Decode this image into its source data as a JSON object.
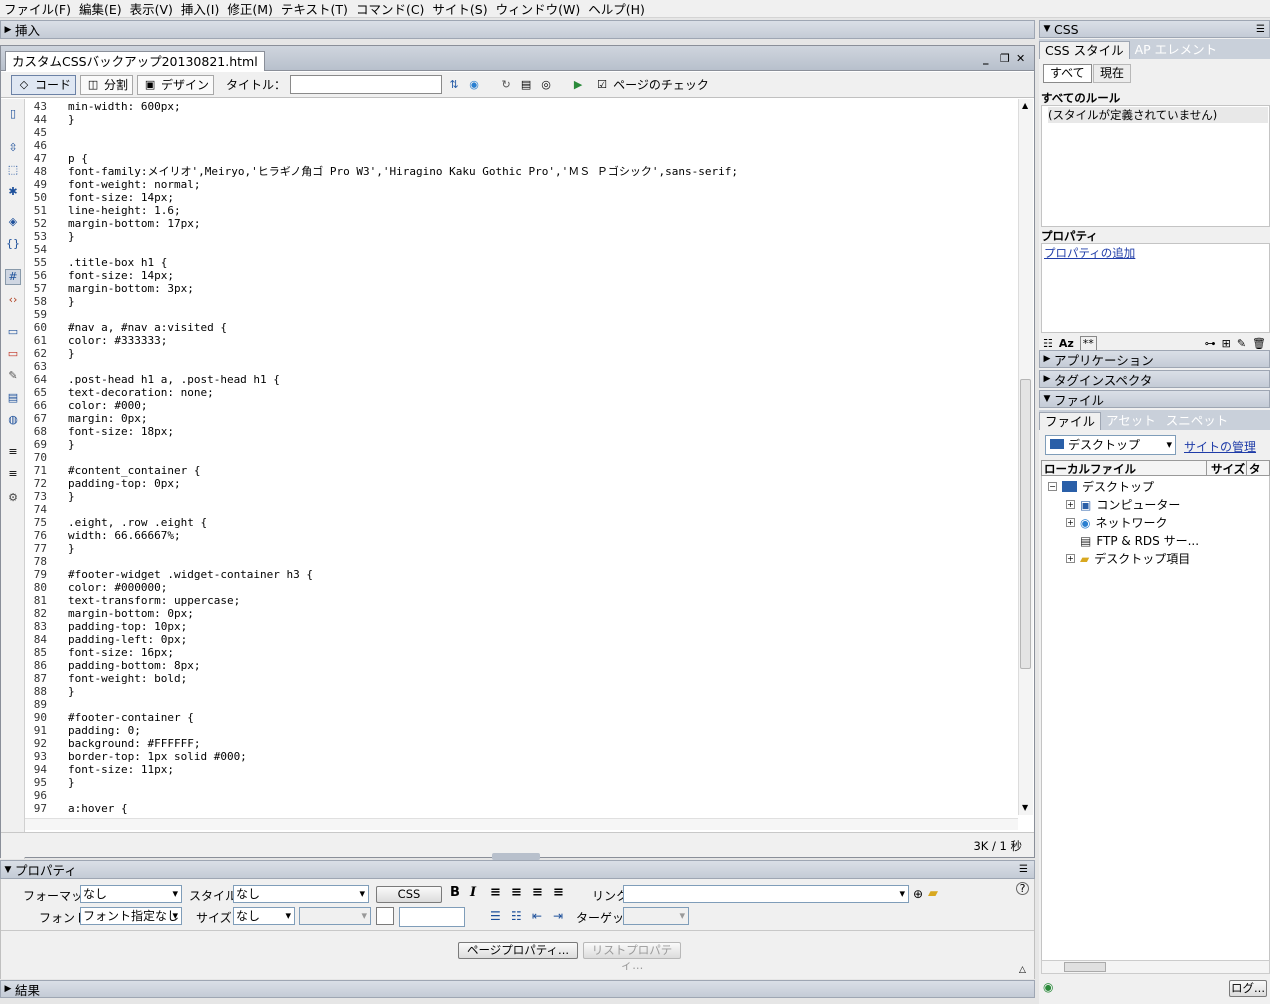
{
  "menu": [
    "ファイル(F)",
    "編集(E)",
    "表示(V)",
    "挿入(I)",
    "修正(M)",
    "テキスト(T)",
    "コマンド(C)",
    "サイト(S)",
    "ウィンドウ(W)",
    "ヘルプ(H)"
  ],
  "insert_panel": {
    "title": "挿入"
  },
  "document": {
    "tab_title": "カスタムCSSバックアップ20130821.html",
    "toolbar": {
      "code": "コード",
      "split": "分割",
      "design": "デザイン",
      "title_label": "タイトル：",
      "title_value": "",
      "check_page": "ページのチェック"
    },
    "lines": [
      {
        "n": "43",
        "t": "min-width: 600px;"
      },
      {
        "n": "44",
        "t": "}"
      },
      {
        "n": "45",
        "t": ""
      },
      {
        "n": "46",
        "t": ""
      },
      {
        "n": "47",
        "t": "p {"
      },
      {
        "n": "48",
        "t": "font-family:メイリオ',Meiryo,'ヒラギノ角ゴ Pro W3','Hiragino Kaku Gothic Pro','ＭＳ Ｐゴシック',sans-serif;"
      },
      {
        "n": "49",
        "t": "font-weight: normal;"
      },
      {
        "n": "50",
        "t": "font-size: 14px;"
      },
      {
        "n": "51",
        "t": "line-height: 1.6;"
      },
      {
        "n": "52",
        "t": "margin-bottom: 17px;"
      },
      {
        "n": "53",
        "t": "}"
      },
      {
        "n": "54",
        "t": ""
      },
      {
        "n": "55",
        "t": ".title-box h1 {"
      },
      {
        "n": "56",
        "t": "font-size: 14px;"
      },
      {
        "n": "57",
        "t": "margin-bottom: 3px;"
      },
      {
        "n": "58",
        "t": "}"
      },
      {
        "n": "59",
        "t": ""
      },
      {
        "n": "60",
        "t": "#nav a, #nav a:visited {"
      },
      {
        "n": "61",
        "t": "color: #333333;"
      },
      {
        "n": "62",
        "t": "}"
      },
      {
        "n": "63",
        "t": ""
      },
      {
        "n": "64",
        "t": ".post-head h1 a, .post-head h1 {"
      },
      {
        "n": "65",
        "t": "text-decoration: none;"
      },
      {
        "n": "66",
        "t": "color: #000;"
      },
      {
        "n": "67",
        "t": "margin: 0px;"
      },
      {
        "n": "68",
        "t": "font-size: 18px;"
      },
      {
        "n": "69",
        "t": "}"
      },
      {
        "n": "70",
        "t": ""
      },
      {
        "n": "71",
        "t": "#content_container {"
      },
      {
        "n": "72",
        "t": "padding-top: 0px;"
      },
      {
        "n": "73",
        "t": "}"
      },
      {
        "n": "74",
        "t": ""
      },
      {
        "n": "75",
        "t": ".eight, .row .eight {"
      },
      {
        "n": "76",
        "t": "width: 66.66667%;"
      },
      {
        "n": "77",
        "t": "}"
      },
      {
        "n": "78",
        "t": ""
      },
      {
        "n": "79",
        "t": "#footer-widget .widget-container h3 {"
      },
      {
        "n": "80",
        "t": "color: #000000;"
      },
      {
        "n": "81",
        "t": "text-transform: uppercase;"
      },
      {
        "n": "82",
        "t": "margin-bottom: 0px;"
      },
      {
        "n": "83",
        "t": "padding-top: 10px;"
      },
      {
        "n": "84",
        "t": "padding-left: 0px;"
      },
      {
        "n": "85",
        "t": "font-size: 16px;"
      },
      {
        "n": "86",
        "t": "padding-bottom: 8px;"
      },
      {
        "n": "87",
        "t": "font-weight: bold;"
      },
      {
        "n": "88",
        "t": "}"
      },
      {
        "n": "89",
        "t": ""
      },
      {
        "n": "90",
        "t": "#footer-container {"
      },
      {
        "n": "91",
        "t": "padding: 0;"
      },
      {
        "n": "92",
        "t": "background: #FFFFFF;"
      },
      {
        "n": "93",
        "t": "border-top: 1px solid #000;"
      },
      {
        "n": "94",
        "t": "font-size: 11px;"
      },
      {
        "n": "95",
        "t": "}"
      },
      {
        "n": "96",
        "t": ""
      },
      {
        "n": "97",
        "t": "a:hover {"
      }
    ],
    "status": "3K / 1 秒"
  },
  "properties_panel": {
    "title": "プロパティ",
    "format_label": "フォーマット",
    "format_value": "なし",
    "style_label": "スタイル",
    "style_value": "なし",
    "css_button": "CSS",
    "bold": "B",
    "italic": "I",
    "link_label": "リンク",
    "link_value": "",
    "font_label": "フォント",
    "font_value": "フォント指定なし",
    "size_label": "サイズ",
    "size_value": "なし",
    "target_label": "ターゲット",
    "page_props_button": "ページプロパティ...",
    "list_props_button": "リストプロパティ...",
    "help": "?"
  },
  "results_panel": {
    "title": "結果"
  },
  "right_panel": {
    "css": {
      "title": "CSS",
      "tab_styles": "CSS スタイル",
      "tab_ap": "AP エレメント",
      "btn_all": "すべて",
      "btn_current": "現在",
      "rules_header": "すべてのルール",
      "rules_empty": "(スタイルが定義されていません)",
      "props_header": "プロパティ",
      "add_property": "プロパティの追加"
    },
    "application": "アプリケーション",
    "tag_inspector": "タグインスペクタ",
    "files": {
      "title": "ファイル",
      "tab_files": "ファイル",
      "tab_assets": "アセット",
      "tab_snippets": "スニペット",
      "location": "デスクトップ",
      "manage_sites": "サイトの管理",
      "col_local": "ローカルファイル",
      "col_size": "サイズ",
      "col_type": "タイ",
      "tree": [
        "デスクトップ",
        "コンピューター",
        "ネットワーク",
        "FTP & RDS サー...",
        "デスクトップ項目"
      ],
      "log_button": "ログ..."
    }
  }
}
